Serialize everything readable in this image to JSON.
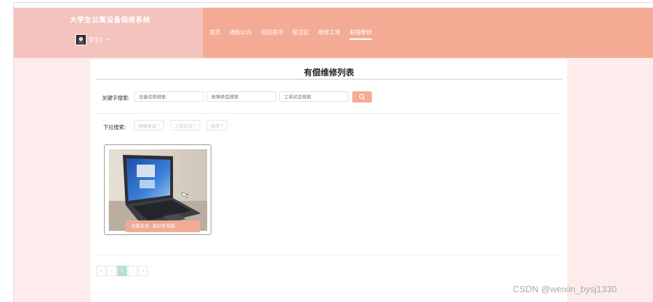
{
  "header": {
    "app_title": "大学生公寓设备保修系统",
    "user_name": "学生1",
    "user_caret": "▾"
  },
  "nav": [
    {
      "label": "首页",
      "active": false
    },
    {
      "label": "通知公告",
      "active": false
    },
    {
      "label": "校园资讯",
      "active": false
    },
    {
      "label": "留言区",
      "active": false
    },
    {
      "label": "维修工单",
      "active": false
    },
    {
      "label": "有偿维修",
      "active": true
    }
  ],
  "page": {
    "title": "有偿维修列表"
  },
  "search": {
    "label": "关键字搜索:",
    "device_name_placeholder": "设备名称搜索",
    "fault_type_placeholder": "故障类型搜索",
    "order_status_placeholder": "工单状态搜索",
    "button_icon": "search-icon"
  },
  "filters": {
    "label": "下拉搜索:",
    "fault_type": "故障类型",
    "order_status": "工单状态",
    "sort": "排序",
    "caret": "▾"
  },
  "items": [
    {
      "caption": "设备名称: 笔记本电脑",
      "image": "laptop-photo"
    }
  ],
  "pagination": {
    "first": "«",
    "prev": "‹",
    "current": "1",
    "next": "›",
    "last": "»"
  },
  "watermark": "CSDN @weixin_bysj1330",
  "colors": {
    "header_left": "#f4c3bd",
    "header_right": "#f3ab94",
    "content_bg": "#fdeceb",
    "accent": "#f3ab94",
    "pager_active": "#b9dcd6"
  }
}
